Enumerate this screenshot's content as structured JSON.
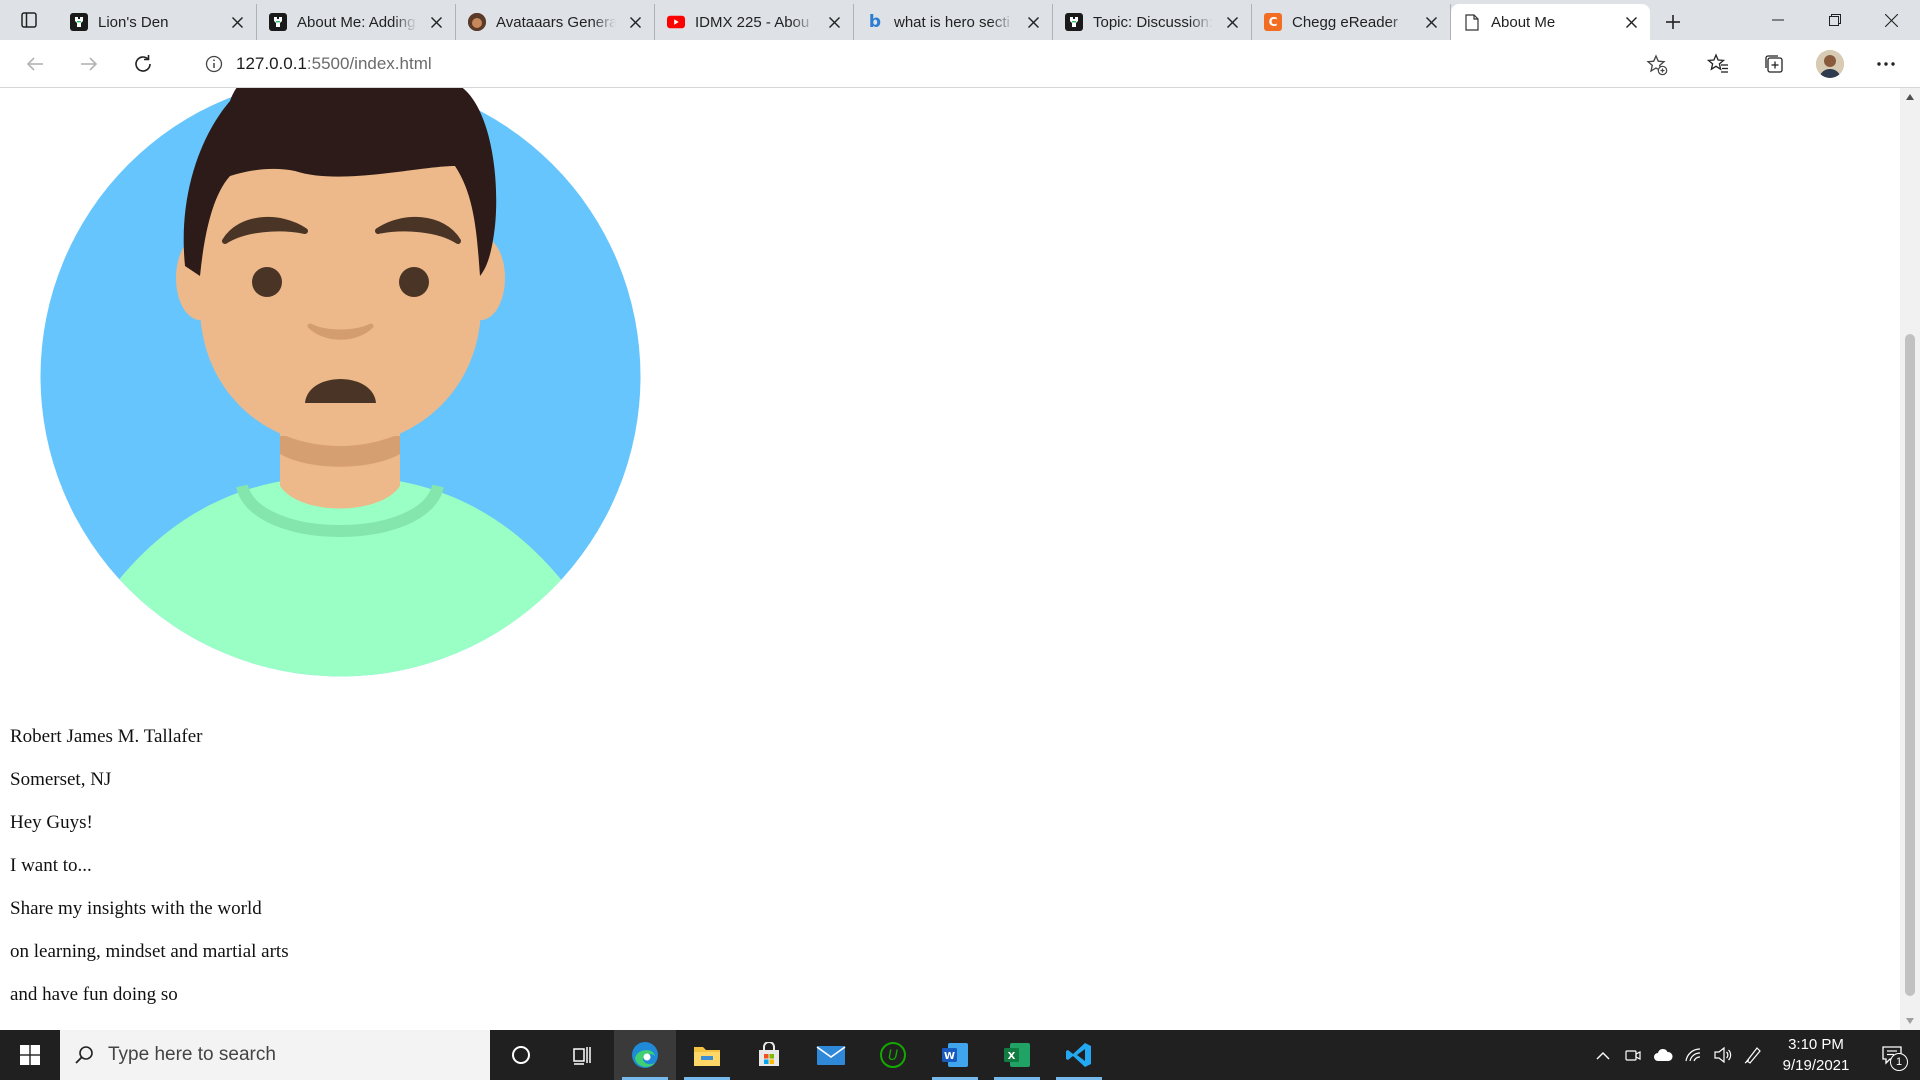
{
  "browser": {
    "tabs": [
      {
        "title": "Lion's Den",
        "favicon": "lions-den-icon",
        "color": "#1a1a1a",
        "glyph": "♜",
        "active": false
      },
      {
        "title": "About Me: Adding",
        "favicon": "lions-den-icon",
        "color": "#1a1a1a",
        "glyph": "♜",
        "active": false
      },
      {
        "title": "Avataaars Genera",
        "favicon": "avataaars-icon",
        "color": "#5b3a29",
        "glyph": "●",
        "active": false
      },
      {
        "title": "IDMX 225 - Abou",
        "favicon": "youtube-icon",
        "color": "#ff0000",
        "glyph": "▶",
        "active": false
      },
      {
        "title": "what is hero secti",
        "favicon": "bing-icon",
        "color": "#ffffff",
        "glyph": "b",
        "active": false
      },
      {
        "title": "Topic: Discussion:",
        "favicon": "lions-den-icon",
        "color": "#1a1a1a",
        "glyph": "♜",
        "active": false
      },
      {
        "title": "Chegg eReader",
        "favicon": "chegg-icon",
        "color": "#f26c21",
        "glyph": "C",
        "active": false
      },
      {
        "title": "About Me",
        "favicon": "page-icon",
        "color": "#ffffff",
        "glyph": "",
        "active": true
      }
    ],
    "address": {
      "host": "127.0.0.1",
      "path": ":5500/index.html"
    }
  },
  "page": {
    "bio_lines": [
      "Robert James M. Tallafer",
      "Somerset, NJ",
      "Hey Guys!",
      "I want to...",
      "Share my insights with the world",
      "on learning, mindset and martial arts",
      "and have fun doing so"
    ],
    "avatar_colors": {
      "background": "#65c5fc",
      "skin": "#edb98a",
      "hair": "#2c1b18",
      "shirt": "#9affc4",
      "eyes_mouth": "#4a3426"
    }
  },
  "taskbar": {
    "search_placeholder": "Type here to search",
    "apps": [
      {
        "name": "cortana-icon",
        "running": false,
        "active": false
      },
      {
        "name": "task-view-icon",
        "running": false,
        "active": false
      },
      {
        "name": "edge-icon",
        "running": true,
        "active": true
      },
      {
        "name": "file-explorer-icon",
        "running": true,
        "active": false
      },
      {
        "name": "microsoft-store-icon",
        "running": false,
        "active": false
      },
      {
        "name": "mail-icon",
        "running": false,
        "active": false
      },
      {
        "name": "upwork-icon",
        "running": false,
        "active": false
      },
      {
        "name": "word-icon",
        "running": true,
        "active": false
      },
      {
        "name": "excel-icon",
        "running": true,
        "active": false
      },
      {
        "name": "vscode-icon",
        "running": true,
        "active": false
      }
    ],
    "time": "3:10 PM",
    "date": "9/19/2021",
    "notification_count": "1"
  }
}
